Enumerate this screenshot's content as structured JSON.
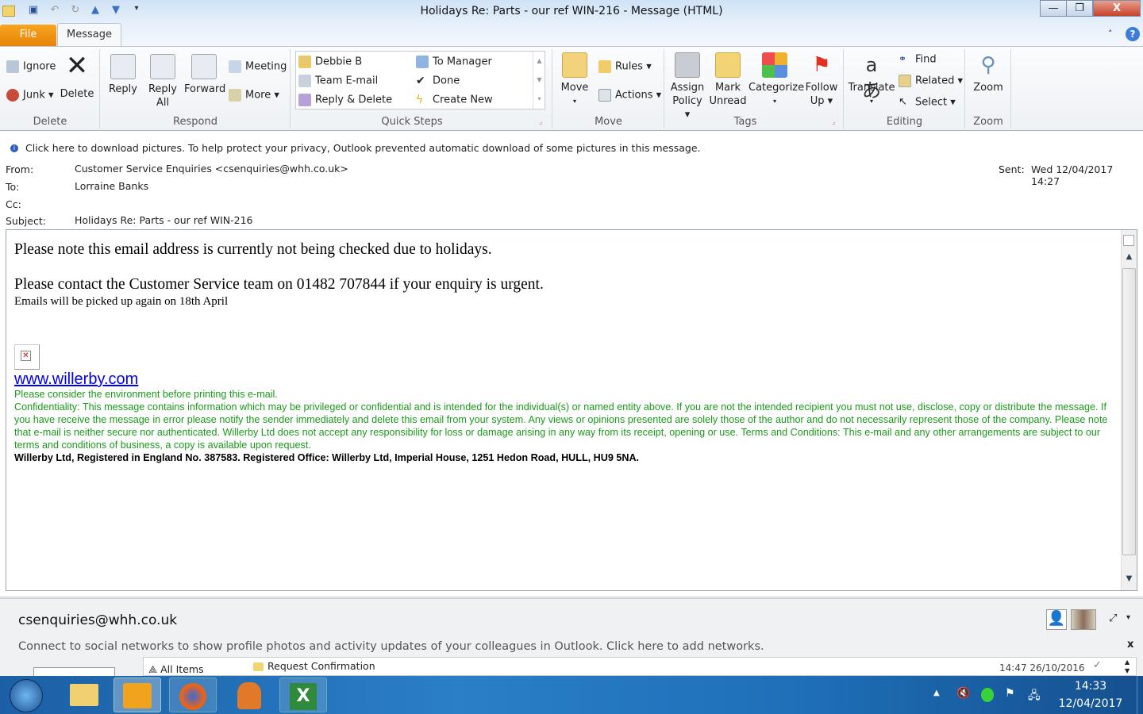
{
  "window": {
    "title": "Holidays Re: Parts - our ref WIN-216  -  Message (HTML)",
    "minimize": "—",
    "restore": "❐",
    "close": "X"
  },
  "tabs": {
    "file": "File",
    "message": "Message"
  },
  "ribbon": {
    "delete_group": {
      "label": "Delete",
      "ignore": "Ignore",
      "junk": "Junk",
      "delete": "Delete"
    },
    "respond_group": {
      "label": "Respond",
      "reply": "Reply",
      "reply_all_1": "Reply",
      "reply_all_2": "All",
      "forward": "Forward",
      "meeting": "Meeting",
      "more": "More"
    },
    "quick_steps": {
      "label": "Quick Steps",
      "items": [
        "Debbie B",
        "To Manager",
        "Team E-mail",
        "Done",
        "Reply & Delete",
        "Create New"
      ]
    },
    "move_group": {
      "label": "Move",
      "move": "Move",
      "rules": "Rules",
      "actions": "Actions"
    },
    "tags_group": {
      "label": "Tags",
      "assign_1": "Assign",
      "assign_2": "Policy",
      "mark_1": "Mark",
      "mark_2": "Unread",
      "categorize": "Categorize",
      "follow_1": "Follow",
      "follow_2": "Up"
    },
    "editing_group": {
      "label": "Editing",
      "translate": "Translate",
      "find": "Find",
      "related": "Related",
      "select": "Select"
    },
    "zoom_group": {
      "label": "Zoom",
      "zoom": "Zoom"
    }
  },
  "infobar": "Click here to download pictures. To help protect your privacy, Outlook prevented automatic download of some pictures in this message.",
  "header": {
    "from_label": "From:",
    "from": "Customer Service Enquiries <csenquiries@whh.co.uk>",
    "to_label": "To:",
    "to": "Lorraine Banks",
    "cc_label": "Cc:",
    "subject_label": "Subject:",
    "subject": "Holidays Re: Parts - our ref WIN-216",
    "sent_label": "Sent:",
    "sent": "Wed 12/04/2017 14:27"
  },
  "body": {
    "line1": "Please note this email address is currently not being checked due to holidays.",
    "line2": "Please contact the Customer Service team on 01482 707844 if your enquiry is urgent.",
    "line3": "Emails will be picked up again on 18th April",
    "link": "www.willerby.com",
    "env": "Please consider the environment before printing this e-mail.",
    "confidentiality": "Confidentiality: This message contains information which may be privileged or confidential and is intended for the individual(s) or named entity above. If you are not the intended recipient you must not use, disclose, copy or distribute the message. If you have receive the message in error please notify the sender immediately and delete this email from your system. Any views or opinions presented are solely those of the author and do not necessarily represent those of the company. Please note that e-mail is neither secure nor authenticated. Willerby Ltd does not accept any responsibility for loss or damage arising in any way from its receipt, opening or use. Terms and Conditions: This e-mail and any other arrangements are subject to our terms and conditions of business, a copy is available upon request.",
    "registered": "Willerby Ltd, Registered in England No. 387583. Registered Office: Willerby Ltd, Imperial House, 1251 Hedon Road, HULL, HU9 5NA."
  },
  "people": {
    "email": "csenquiries@whh.co.uk",
    "social": "Connect to social networks to show profile photos and activity updates of your colleagues in Outlook. Click here to add networks.",
    "close": "x",
    "all_items": "All Items",
    "item_subject": "Request Confirmation",
    "item_date": "14:47  26/10/2016"
  },
  "taskbar": {
    "time": "14:33",
    "date": "12/04/2017"
  }
}
